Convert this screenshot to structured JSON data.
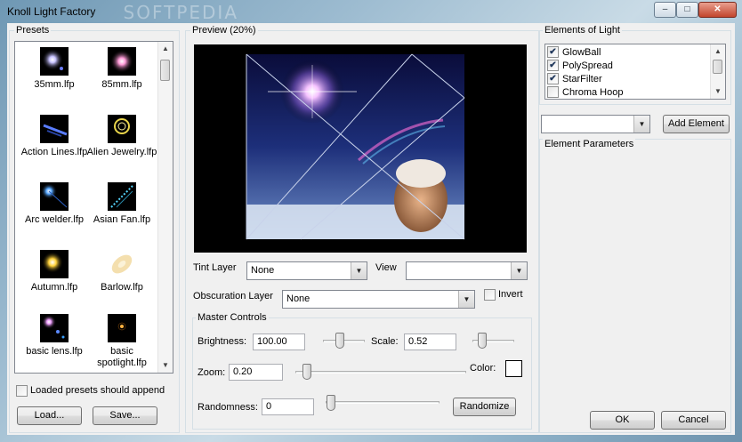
{
  "window": {
    "title": "Knoll Light Factory",
    "watermark": "SOFTPEDIA",
    "min_glyph": "–",
    "max_glyph": "□",
    "close_glyph": "✕"
  },
  "presets": {
    "group_label": "Presets",
    "items": [
      {
        "label": "35mm.lfp",
        "icon": "flare-35mm-icon"
      },
      {
        "label": "85mm.lfp",
        "icon": "flare-85mm-icon"
      },
      {
        "label": "Action Lines.lfp",
        "icon": "action-lines-icon"
      },
      {
        "label": "Alien Jewelry.lfp",
        "icon": "alien-jewelry-icon"
      },
      {
        "label": "Arc welder.lfp",
        "icon": "arc-welder-icon"
      },
      {
        "label": "Asian Fan.lfp",
        "icon": "asian-fan-icon"
      },
      {
        "label": "Autumn.lfp",
        "icon": "autumn-icon"
      },
      {
        "label": "Barlow.lfp",
        "icon": "barlow-icon"
      },
      {
        "label": "basic lens.lfp",
        "icon": "basic-lens-icon"
      },
      {
        "label": "basic spotlight.lfp",
        "icon": "basic-spotlight-icon"
      }
    ],
    "append_label": "Loaded presets should append",
    "load_label": "Load...",
    "save_label": "Save..."
  },
  "preview": {
    "group_label": "Preview (20%)"
  },
  "tint": {
    "label": "Tint Layer",
    "value": "None"
  },
  "view": {
    "label": "View",
    "value": ""
  },
  "obscuration": {
    "label": "Obscuration Layer",
    "value": "None",
    "invert_label": "Invert"
  },
  "master": {
    "group_label": "Master Controls",
    "brightness_label": "Brightness:",
    "brightness_value": "100.00",
    "scale_label": "Scale:",
    "scale_value": "0.52",
    "zoom_label": "Zoom:",
    "zoom_value": "0.20",
    "color_label": "Color:",
    "randomness_label": "Randomness:",
    "randomness_value": "0",
    "randomize_label": "Randomize"
  },
  "elements": {
    "group_label": "Elements of Light",
    "items": [
      {
        "label": "GlowBall",
        "checked": true
      },
      {
        "label": "PolySpread",
        "checked": true
      },
      {
        "label": "StarFilter",
        "checked": true
      },
      {
        "label": "Chroma Hoop",
        "checked": false
      }
    ],
    "add_label": "Add Element",
    "params_label": "Element Parameters"
  },
  "dialog": {
    "ok_label": "OK",
    "cancel_label": "Cancel"
  },
  "glyphs": {
    "check": "✔",
    "down": "▼",
    "up": "▲"
  }
}
